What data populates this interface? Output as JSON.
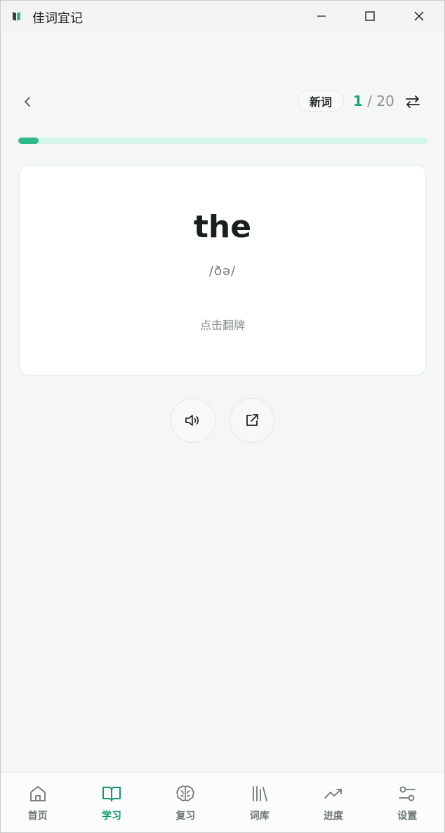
{
  "window": {
    "title": "佳词宜记",
    "controls": {
      "minimize": "minimize-icon",
      "maximize": "maximize-icon",
      "close": "close-icon"
    }
  },
  "header": {
    "badge": "新词",
    "counter_current": "1",
    "counter_total": "/ 20"
  },
  "progress": {
    "fraction": 0.05,
    "color": "#2fb88a",
    "track_color": "#d6f5e9"
  },
  "card": {
    "word": "the",
    "phonetic": "/ðə/",
    "hint": "点击翻牌"
  },
  "actions": [
    {
      "icon": "speaker-icon"
    },
    {
      "icon": "external-link-icon"
    }
  ],
  "nav": {
    "items": [
      {
        "label": "首页",
        "icon": "home-icon",
        "active": false
      },
      {
        "label": "学习",
        "icon": "book-icon",
        "active": true
      },
      {
        "label": "复习",
        "icon": "brain-icon",
        "active": false
      },
      {
        "label": "词库",
        "icon": "library-icon",
        "active": false
      },
      {
        "label": "进度",
        "icon": "trending-up-icon",
        "active": false
      },
      {
        "label": "设置",
        "icon": "settings-sliders-icon",
        "active": false
      }
    ]
  },
  "colors": {
    "accent": "#1aa37a",
    "active_nav": "#169671",
    "background": "#f5f7f6"
  }
}
